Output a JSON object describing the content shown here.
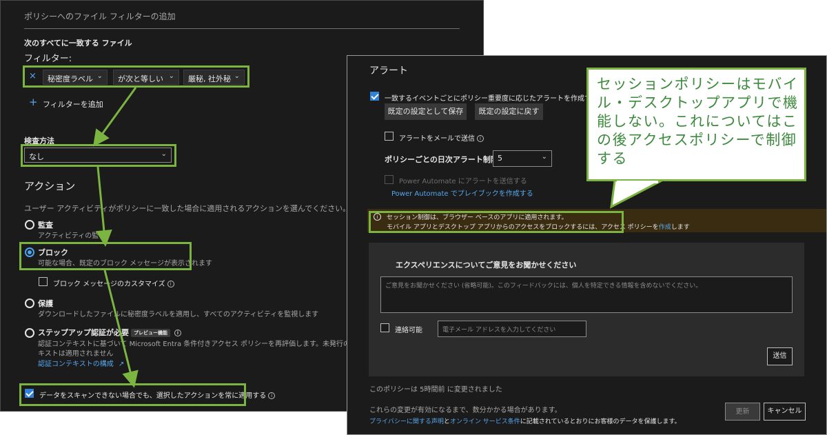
{
  "left": {
    "title": "ポリシーへのファイル フィルターの追加",
    "match_all_files": "次のすべてに一致する ファイル",
    "filter_label": "フィルター:",
    "filter": {
      "remove_symbol": "×",
      "field": "秘密度ラベル",
      "operator": "が次と等しい",
      "value": "厳秘, 社外秘",
      "chevron": "⌄"
    },
    "add_filter_symbol": "+",
    "add_filter": "フィルターを追加",
    "inspection_label": "検査方法",
    "inspection_value": "なし",
    "action_heading": "アクション",
    "action_desc": "ユーザー アクティビティがポリシーに一致した場合に適用されるアクションを選んでください。",
    "actions": {
      "audit_title": "監査",
      "audit_desc": "アクティビティの監視",
      "block_title": "ブロック",
      "block_desc": "可能な場合、既定のブロック メッセージが表示されます",
      "customize_block": "ブロック メッセージのカスタマイズ",
      "protect_title": "保護",
      "protect_desc": "ダウンロードしたファイルに秘密度ラベルを適用し、すべてのアクティビティを監視します",
      "stepup_title": "ステップアップ認証が必要",
      "preview_badge": "プレビュー機能",
      "stepup_desc_1": "認証コンテキストに基づいて Microsoft Entra 条件付きアクセス ポリシーを再評価します。未発行の認証コンテ",
      "stepup_desc_2": "キストは適用されません",
      "auth_context_link": "認証コンテキストの構成",
      "external_icon": "↗"
    },
    "always_apply": "データをスキャンできない場合でも、選択したアクションを常に適用する",
    "info": "i"
  },
  "right": {
    "alerts_heading": "アラート",
    "create_alert": "一致するイベントごとにポリシー重要度に応じたアラートを作成する",
    "save_default": "既定の設定として保存",
    "restore_default": "既定の設定に戻す",
    "email_alert": "アラートをメールで送信",
    "daily_limit_label": "ポリシーごとの日次アラート制限",
    "daily_limit_value": "5",
    "power_automate_send": "Power Automate にアラートを送信する",
    "power_automate_link": "Power Automate でプレイブックを作成する",
    "session_note_1": "セッション制御は、ブラウザー ベースのアプリに適用されます。",
    "session_note_2a": "モバイル アプリとデスクトップ アプリからのアクセスをブロックするには、アクセス ポリシーを",
    "session_note_link": "作成",
    "session_note_2b": "します",
    "feedback_heading": "エクスペリエンスについてご意見をお聞かせください",
    "feedback_placeholder": "ご意見をお聞かせください (省略可能)。このフィードバックには、個人を特定できる情報を含めないでください。",
    "contact_label": "連絡可能",
    "email_placeholder": "電子メール アドレスを入力してください",
    "send": "送信",
    "modified": "このポリシーは 5時間前 に変更されました",
    "changes_note": "これらの変更が有効になるまで、数分かかる場合があります。",
    "privacy_link": "プライバシーに関する声明",
    "and": "と",
    "terms_link": "オンライン サービス条件",
    "privacy_tail": "に記載されているとおりにお客様のデータを保護します。",
    "update": "更新",
    "cancel": "キャンセル",
    "info": "i"
  },
  "callout": {
    "text": "セッションポリシーはモバイル・デスクトップアプリで機能しない。これについてはこの後アクセスポリシーで制御する"
  },
  "colors": {
    "highlight": "#7cb442",
    "callout_text": "#3c8a3c",
    "panel_bg": "#1b1b1b",
    "link": "#56a7ef",
    "warning_bg": "#3a2c10"
  }
}
